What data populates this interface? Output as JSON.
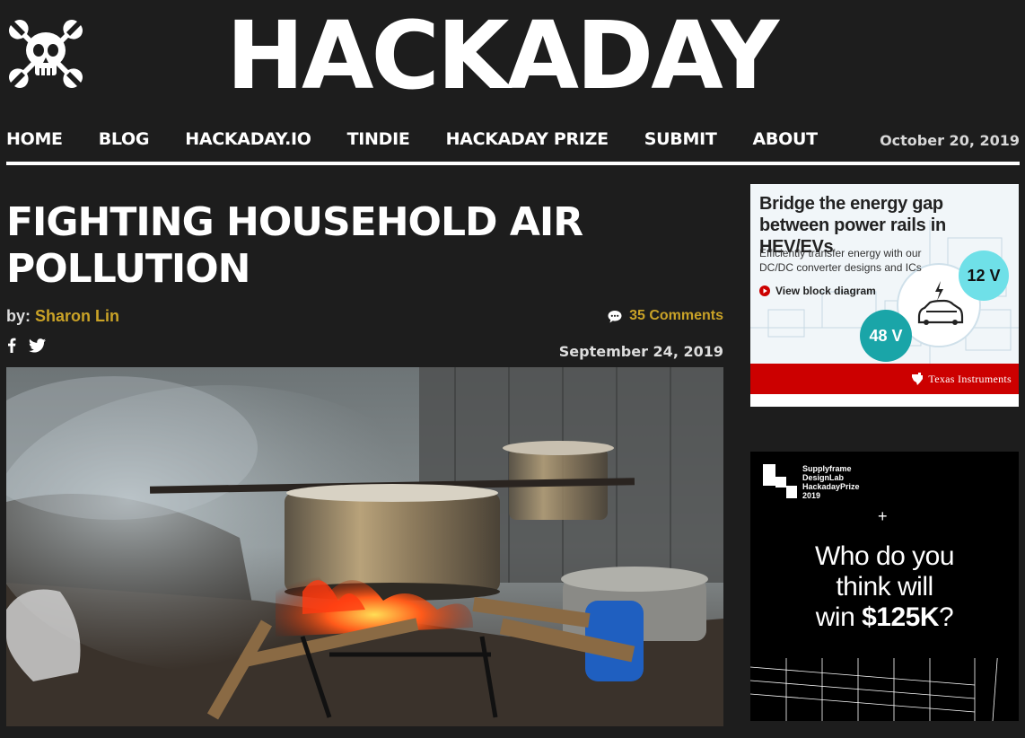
{
  "site": {
    "name": "HACKADAY",
    "date": "October 20, 2019"
  },
  "nav": [
    "HOME",
    "BLOG",
    "HACKADAY.IO",
    "TINDIE",
    "HACKADAY PRIZE",
    "SUBMIT",
    "ABOUT"
  ],
  "article": {
    "title": "FIGHTING HOUSEHOLD AIR POLLUTION",
    "by_prefix": "by:",
    "author": "Sharon Lin",
    "comments": "35 Comments",
    "date": "September 24, 2019"
  },
  "ad_ti": {
    "title": "Bridge the energy gap between power rails in HEV/EVs",
    "subtitle": "Efficiently transfer energy with our DC/DC converter designs and ICs",
    "link": "View block diagram",
    "badge_12v": "12 V",
    "badge_48v": "48 V",
    "brand": "Texas Instruments",
    "colors": {
      "red": "#cc0000",
      "teal": "#1aa5a8",
      "cyan": "#6fe0e8"
    }
  },
  "ad_prize": {
    "brand_lines": [
      "Supplyframe",
      "DesignLab",
      "HackadayPrize",
      "2019"
    ],
    "line1": "Who do you",
    "line2": "think will",
    "line3_pre": "win ",
    "line3_amount": "$125K",
    "line3_post": "?"
  },
  "icons": [
    "skull-wrench-logo",
    "comment-icon",
    "facebook-icon",
    "twitter-icon",
    "play-icon",
    "ti-logo-icon",
    "car-icon"
  ]
}
